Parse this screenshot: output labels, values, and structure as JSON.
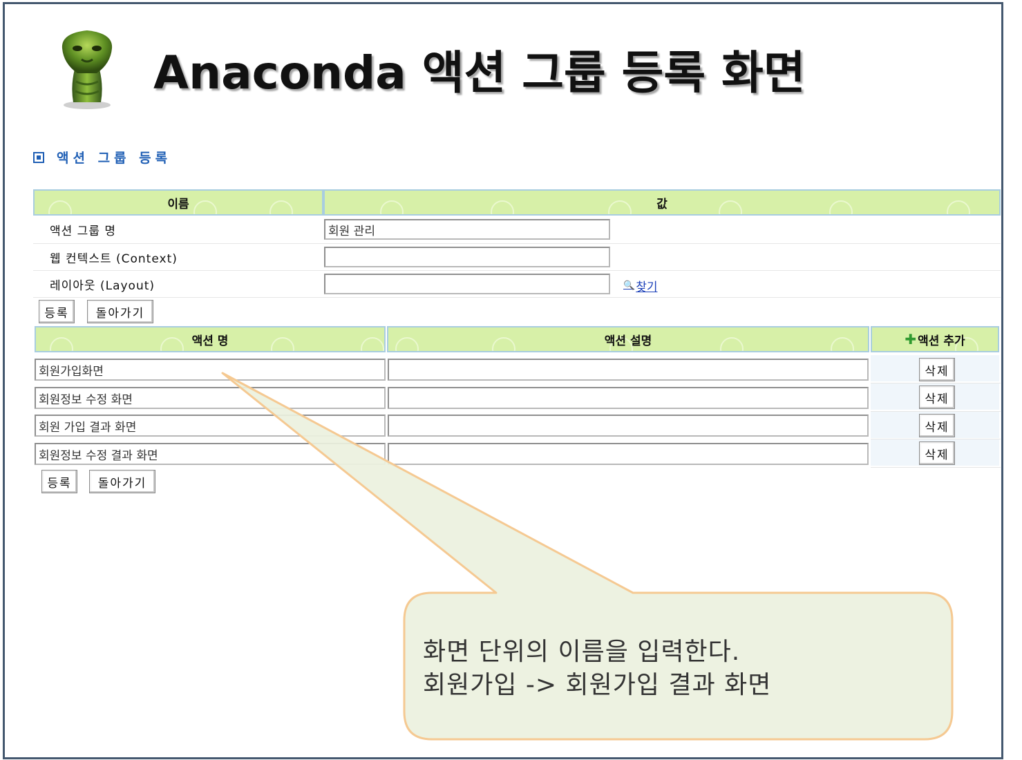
{
  "title": "Anaconda 액션 그룹 등록 화면",
  "logo_icon": "cobra-snake-icon",
  "section_title": "액션 그룹 등록",
  "form": {
    "headers": {
      "name": "이름",
      "value": "값"
    },
    "rows": [
      {
        "label": "액션 그룹 명",
        "value": "회원 관리"
      },
      {
        "label": "웹 컨텍스트 (Context)",
        "value": ""
      },
      {
        "label": "레이아웃 (Layout)",
        "value": ""
      }
    ],
    "find_link": "찾기",
    "find_icon": "magnifier-icon"
  },
  "buttons": {
    "register": "등록",
    "back": "돌아가기"
  },
  "actions": {
    "headers": {
      "name": "액션 명",
      "description": "액션 설명",
      "add": "액션 추가"
    },
    "add_icon": "plus-icon",
    "rows": [
      {
        "name": "회원가입화면",
        "description": "",
        "delete": "삭제"
      },
      {
        "name": "회원정보 수정 화면",
        "description": "",
        "delete": "삭제"
      },
      {
        "name": "회원 가입 결과 화면",
        "description": "",
        "delete": "삭제"
      },
      {
        "name": "회원정보 수정 결과 화면",
        "description": "",
        "delete": "삭제"
      }
    ]
  },
  "callout": {
    "line1": "화면 단위의 이름을 입력한다.",
    "line2": "회원가입 -> 회원가입 결과 화면"
  },
  "colors": {
    "header_bg": "#d7f0a8",
    "header_border": "#a8cde0",
    "section_title": "#1f5fb5",
    "link": "#1a3fb8",
    "callout_fill": "#ebf1de",
    "callout_border": "#f5c992",
    "frame": "#44586f"
  }
}
